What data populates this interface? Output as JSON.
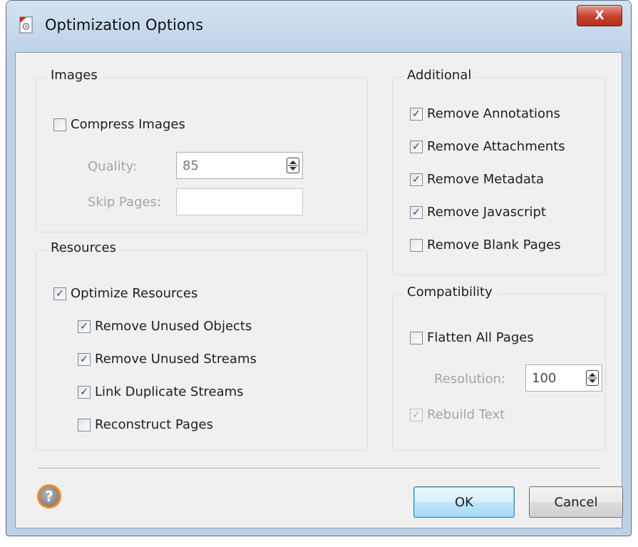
{
  "window": {
    "title": "Optimization Options",
    "close_label": "X"
  },
  "images": {
    "legend": "Images",
    "compress": {
      "label": "Compress Images",
      "checked": false
    },
    "quality": {
      "label": "Quality:",
      "value": "85"
    },
    "skip_pages": {
      "label": "Skip Pages:",
      "value": ""
    }
  },
  "resources": {
    "legend": "Resources",
    "optimize": {
      "label": "Optimize Resources",
      "checked": true
    },
    "items": [
      {
        "label": "Remove Unused Objects",
        "checked": true
      },
      {
        "label": "Remove Unused Streams",
        "checked": true
      },
      {
        "label": "Link Duplicate Streams",
        "checked": true
      },
      {
        "label": "Reconstruct Pages",
        "checked": false
      }
    ]
  },
  "additional": {
    "legend": "Additional",
    "items": [
      {
        "label": "Remove Annotations",
        "checked": true
      },
      {
        "label": "Remove Attachments",
        "checked": true
      },
      {
        "label": "Remove Metadata",
        "checked": true
      },
      {
        "label": "Remove Javascript",
        "checked": true
      },
      {
        "label": "Remove Blank Pages",
        "checked": false
      }
    ]
  },
  "compatibility": {
    "legend": "Compatibility",
    "flatten": {
      "label": "Flatten All Pages",
      "checked": false
    },
    "resolution": {
      "label": "Resolution:",
      "value": "100"
    },
    "rebuild": {
      "label": "Rebuild Text",
      "checked": true,
      "disabled": true
    }
  },
  "buttons": {
    "ok": "OK",
    "cancel": "Cancel",
    "help": "?"
  },
  "colors": {
    "accent": "#3c7fb1",
    "close": "#c6412e",
    "help_ring": "#f08a24"
  }
}
